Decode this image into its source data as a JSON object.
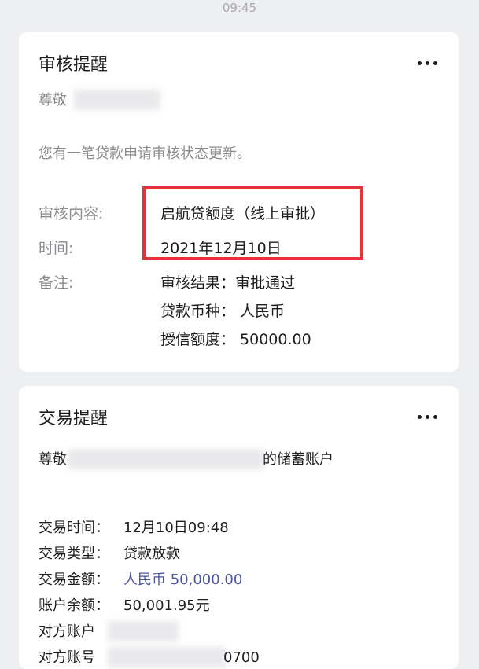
{
  "status_bar": {
    "time": "09:45"
  },
  "audit_card": {
    "title": "审核提醒",
    "greeting": "尊敬",
    "message": "您有一笔贷款申请审核状态更新。",
    "fields": {
      "content_label": "审核内容:",
      "content_value": "启航贷额度（线上审批）",
      "time_label": "时间:",
      "time_value": "2021年12月10日",
      "remark_label": "备注:",
      "remark_line1": "审核结果：审批通过",
      "remark_line2": "贷款币种：  人民币",
      "remark_line3": "授信额度：  50000.00"
    },
    "highlight_color": "#e8313d"
  },
  "transaction_card": {
    "title": "交易提醒",
    "greeting_start": "尊敬",
    "greeting_end": "的储蓄账户",
    "rows": [
      {
        "label": "交易时间：",
        "value": "12月10日09:48"
      },
      {
        "label": "交易类型：",
        "value": "贷款放款"
      },
      {
        "label": "交易金额：",
        "value": "人民币 50,000.00"
      },
      {
        "label": "账户余额：",
        "value": "50,001.95元"
      },
      {
        "label": "对方账户",
        "value": ""
      },
      {
        "label": "对方账号",
        "value": "0700"
      }
    ],
    "amount_color": "#4a55a2"
  },
  "icons": {
    "more": "more-dots-icon"
  }
}
